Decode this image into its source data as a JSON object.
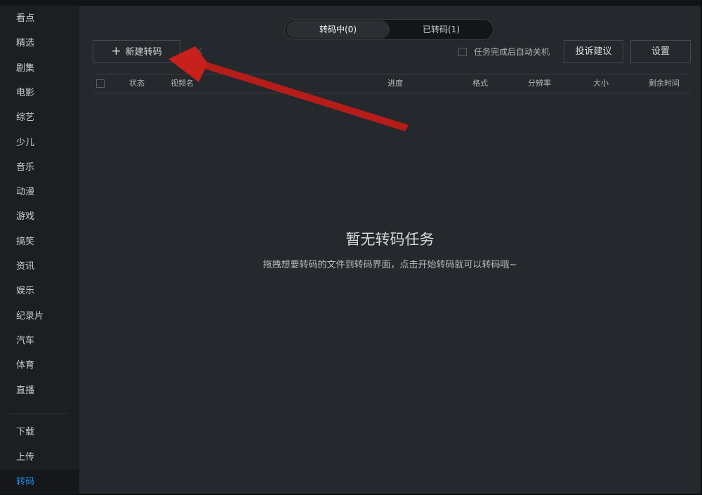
{
  "sidebar": {
    "items": [
      {
        "label": "看点",
        "name": "sidebar-item-kandian",
        "active": false
      },
      {
        "label": "精选",
        "name": "sidebar-item-jingxuan",
        "active": false
      },
      {
        "label": "剧集",
        "name": "sidebar-item-juji",
        "active": false
      },
      {
        "label": "电影",
        "name": "sidebar-item-dianying",
        "active": false
      },
      {
        "label": "综艺",
        "name": "sidebar-item-zongyi",
        "active": false
      },
      {
        "label": "少儿",
        "name": "sidebar-item-shaoer",
        "active": false
      },
      {
        "label": "音乐",
        "name": "sidebar-item-yinyue",
        "active": false
      },
      {
        "label": "动漫",
        "name": "sidebar-item-dongman",
        "active": false
      },
      {
        "label": "游戏",
        "name": "sidebar-item-youxi",
        "active": false
      },
      {
        "label": "搞笑",
        "name": "sidebar-item-gaoxiao",
        "active": false
      },
      {
        "label": "资讯",
        "name": "sidebar-item-zixun",
        "active": false
      },
      {
        "label": "娱乐",
        "name": "sidebar-item-yule",
        "active": false
      },
      {
        "label": "纪录片",
        "name": "sidebar-item-jilupian",
        "active": false
      },
      {
        "label": "汽车",
        "name": "sidebar-item-qiche",
        "active": false
      },
      {
        "label": "体育",
        "name": "sidebar-item-tiyu",
        "active": false
      },
      {
        "label": "直播",
        "name": "sidebar-item-zhibo",
        "active": false
      }
    ],
    "bottom_items": [
      {
        "label": "下载",
        "name": "sidebar-item-download",
        "active": false
      },
      {
        "label": "上传",
        "name": "sidebar-item-upload",
        "active": false
      },
      {
        "label": "转码",
        "name": "sidebar-item-transcode",
        "active": true
      }
    ]
  },
  "tabs": {
    "transcoding": "转码中(0)",
    "transcoded": "已转码(1)"
  },
  "toolbar": {
    "new_transcode_label": "新建转码",
    "close_glyph": "×",
    "auto_shutdown_label": "任务完成后自动关机",
    "feedback_label": "投诉建议",
    "settings_label": "设置"
  },
  "table": {
    "columns": {
      "status": "状态",
      "video_name": "视频名",
      "progress": "进度",
      "format": "格式",
      "resolution": "分辨率",
      "size": "大小",
      "remaining_time": "剩余时间"
    }
  },
  "empty_state": {
    "title": "暂无转码任务",
    "subtitle": "拖拽想要转码的文件到转码界面，点击开始转码就可以转码哦~"
  },
  "colors": {
    "background": "#25282c",
    "sidebar": "#1c1e21",
    "accent_active": "#1e8ff0",
    "annotation_arrow": "#c8201c"
  },
  "icons": {
    "plus": "plus-icon",
    "close": "close-icon",
    "annotation": "red-arrow-annotation"
  }
}
